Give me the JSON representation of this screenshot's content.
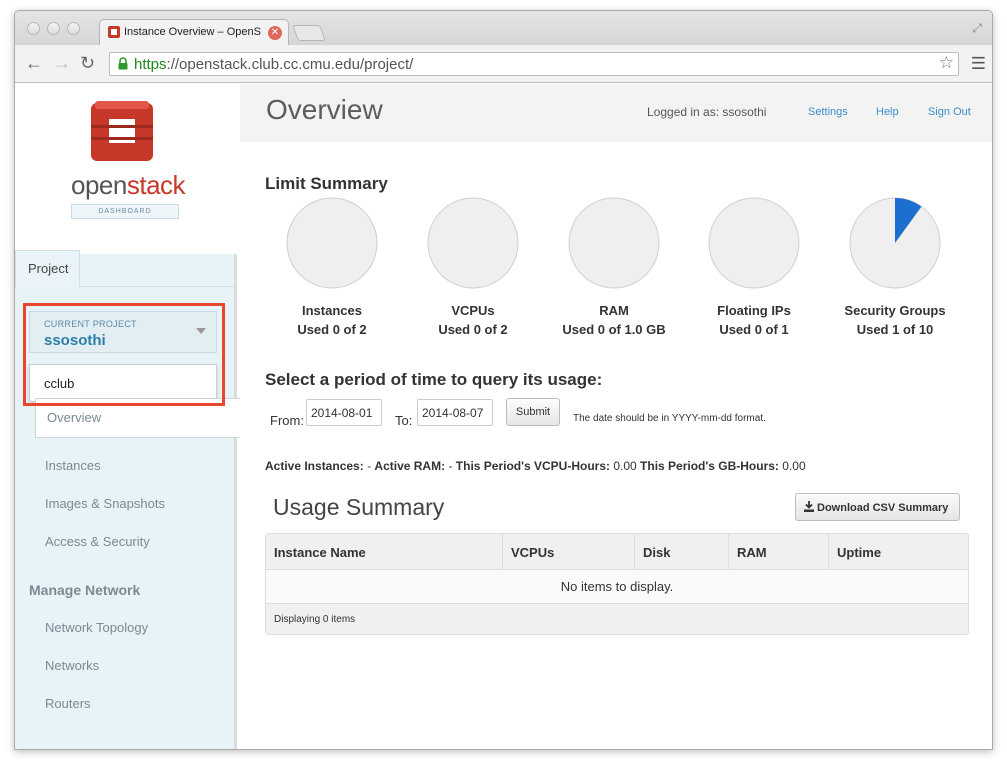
{
  "browser": {
    "tab_title": "Instance Overview – OpenS",
    "url_scheme": "https",
    "url_rest": "://openstack.club.cc.cmu.edu/project/"
  },
  "sidebar": {
    "logo_open": "open",
    "logo_stack": "stack",
    "logo_sub": "DASHBOARD",
    "project_tab": "Project",
    "current_project_caption": "CURRENT PROJECT",
    "current_project": "ssosothi",
    "dropdown_option": "cclub",
    "nav_items": [
      {
        "label": "Overview"
      },
      {
        "label": "Instances"
      },
      {
        "label": "Images & Snapshots"
      },
      {
        "label": "Access & Security"
      }
    ],
    "section_heading": "Manage Network",
    "network_items": [
      {
        "label": "Network Topology"
      },
      {
        "label": "Networks"
      },
      {
        "label": "Routers"
      }
    ]
  },
  "header": {
    "title": "Overview",
    "logged_in": "Logged in as: ssosothi",
    "settings": "Settings",
    "help": "Help",
    "sign_out": "Sign Out"
  },
  "limits": {
    "heading": "Limit Summary",
    "items": [
      {
        "label": "Instances",
        "used": "Used 0 of 2",
        "fraction": 0
      },
      {
        "label": "VCPUs",
        "used": "Used 0 of 2",
        "fraction": 0
      },
      {
        "label": "RAM",
        "used": "Used 0 of 1.0 GB",
        "fraction": 0
      },
      {
        "label": "Floating IPs",
        "used": "Used 0 of 1",
        "fraction": 0
      },
      {
        "label": "Security Groups",
        "used": "Used 1 of 10",
        "fraction": 0.1
      }
    ],
    "pie_fill": "#efefef",
    "pie_used": "#1c6fcf"
  },
  "query": {
    "heading": "Select a period of time to query its usage:",
    "from_label": "From:",
    "from_value": "2014-08-01",
    "to_label": "To:",
    "to_value": "2014-08-07",
    "submit": "Submit",
    "hint": "The date should be in YYYY-mm-dd format."
  },
  "stats": {
    "active_instances_label": "Active Instances:",
    "active_instances": "-",
    "active_ram_label": "Active RAM:",
    "active_ram": "-",
    "vcpu_hours_label": "This Period's VCPU-Hours:",
    "vcpu_hours": "0.00",
    "gb_hours_label": "This Period's GB-Hours:",
    "gb_hours": "0.00"
  },
  "usage": {
    "heading": "Usage Summary",
    "download": "Download CSV Summary",
    "columns": [
      "Instance Name",
      "VCPUs",
      "Disk",
      "RAM",
      "Uptime"
    ],
    "empty": "No items to display.",
    "footer": "Displaying 0 items"
  }
}
